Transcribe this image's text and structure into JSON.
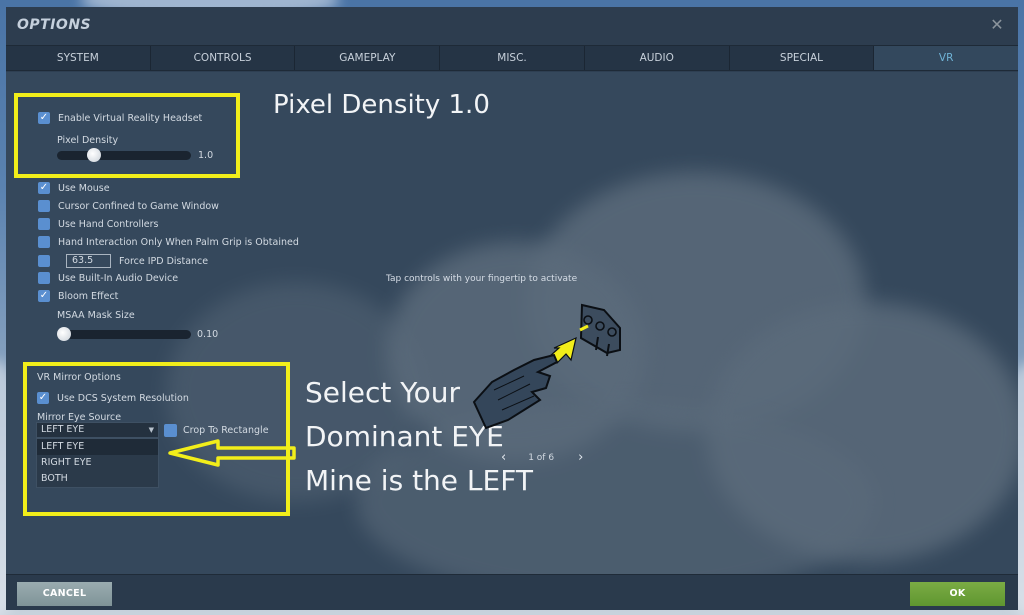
{
  "window": {
    "title": "OPTIONS",
    "close_icon": "close-icon"
  },
  "tabs": [
    {
      "label": "SYSTEM",
      "active": false
    },
    {
      "label": "CONTROLS",
      "active": false
    },
    {
      "label": "GAMEPLAY",
      "active": false
    },
    {
      "label": "MISC.",
      "active": false
    },
    {
      "label": "AUDIO",
      "active": false
    },
    {
      "label": "SPECIAL",
      "active": false
    },
    {
      "label": "VR",
      "active": true
    }
  ],
  "vr": {
    "enable_headset": {
      "label": "Enable Virtual Reality Headset",
      "checked": true
    },
    "pixel_density": {
      "label": "Pixel Density",
      "value": "1.0",
      "fraction": 0.25
    },
    "options": [
      {
        "label": "Use Mouse",
        "checked": true
      },
      {
        "label": "Cursor Confined to Game Window",
        "checked": false
      },
      {
        "label": "Use Hand Controllers",
        "checked": false
      },
      {
        "label": "Hand Interaction Only When Palm Grip is Obtained",
        "checked": false
      }
    ],
    "ipd": {
      "checked": false,
      "value": "63.5",
      "label": "Force IPD Distance"
    },
    "options2": [
      {
        "label": "Use Built-In Audio Device",
        "checked": false
      },
      {
        "label": "Bloom Effect",
        "checked": true
      }
    ],
    "msaa": {
      "label": "MSAA Mask Size",
      "value": "0.10",
      "fraction": 0.0
    },
    "mirror": {
      "title": "VR Mirror Options",
      "use_dcs_resolution": {
        "label": "Use DCS System Resolution",
        "checked": true
      },
      "eye_source_label": "Mirror Eye Source",
      "selected": "LEFT EYE",
      "dropdown_options": [
        "LEFT EYE",
        "RIGHT EYE",
        "BOTH"
      ],
      "crop": {
        "label": "Crop To Rectangle",
        "checked": false
      }
    }
  },
  "tutorial": {
    "hint": "Tap controls with your fingertip to activate",
    "page": "1 of 6",
    "prev_icon": "chevron-left-icon",
    "next_icon": "chevron-right-icon"
  },
  "annotations": {
    "pixel_density_note": "Pixel Density 1.0",
    "eye_note_line1": "Select Your",
    "eye_note_line2": "Dominant EYE",
    "eye_note_line3": "Mine is the LEFT",
    "highlight_color": "#f2ee1a"
  },
  "footer": {
    "cancel_label": "CANCEL",
    "ok_label": "OK"
  },
  "colors": {
    "accent_tab": "#6fb3d6",
    "checkbox": "#5a8fd0",
    "ok_button": "#6ea23a",
    "cancel_button": "#8ea1a5"
  }
}
